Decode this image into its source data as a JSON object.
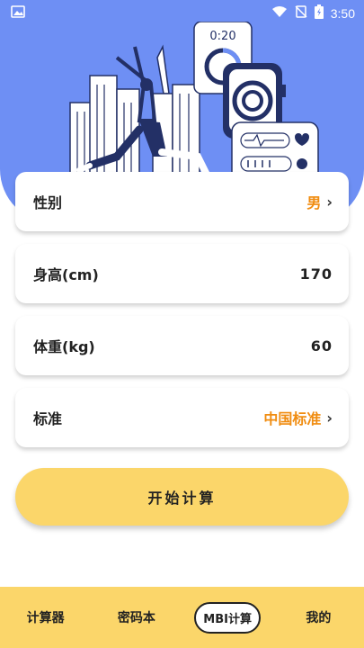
{
  "status_bar": {
    "time": "3:50",
    "icons": [
      "image-icon",
      "wifi-icon",
      "signal-off-icon",
      "battery-charging-icon"
    ]
  },
  "illustration": {
    "watch_time": "0:20"
  },
  "form": {
    "gender": {
      "label": "性别",
      "value": "男"
    },
    "height": {
      "label": "身高(cm)",
      "value": "170"
    },
    "weight": {
      "label": "体重(kg)",
      "value": "60"
    },
    "standard": {
      "label": "标准",
      "value": "中国标准"
    }
  },
  "start_button": "开始计算",
  "tabbar": {
    "tabs": [
      "计算器",
      "密码本",
      "MBI计算",
      "我的"
    ],
    "active_index": 2
  },
  "colors": {
    "hero": "#6e8ff4",
    "accent_yellow": "#fbd66a",
    "value_orange": "#f08c10"
  }
}
